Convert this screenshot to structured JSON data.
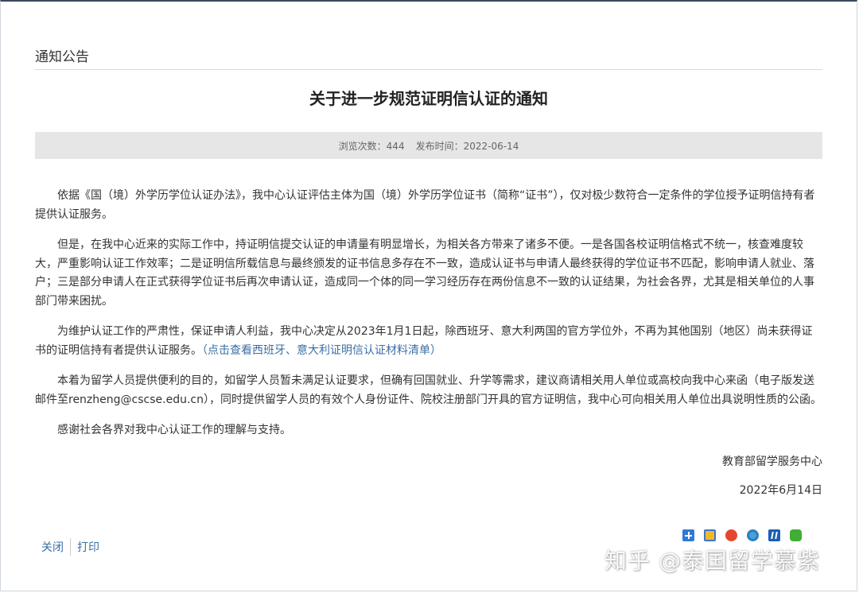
{
  "section": {
    "title": "通知公告"
  },
  "article": {
    "title": "关于进一步规范证明信认证的通知",
    "meta": {
      "views_label": "浏览次数：",
      "views": "444",
      "date_label": "发布时间：",
      "date": "2022-06-14"
    },
    "paragraphs": [
      "依据《国（境）外学历学位认证办法》，我中心认证评估主体为国（境）外学历学位证书（简称“证书”），仅对极少数符合一定条件的学位授予证明信持有者提供认证服务。",
      "但是，在我中心近来的实际工作中，持证明信提交认证的申请量有明显增长，为相关各方带来了诸多不便。一是各国各校证明信格式不统一，核查难度较大，严重影响认证工作效率；二是证明信所载信息与最终颁发的证书信息多存在不一致，造成认证书与申请人最终获得的学位证书不匹配，影响申请人就业、落户；三是部分申请人在正式获得学位证书后再次申请认证，造成同一个体的同一学习经历存在两份信息不一致的认证结果，为社会各界，尤其是相关单位的人事部门带来困扰。",
      "为维护认证工作的严肃性，保证申请人利益，我中心决定从2023年1月1日起，除西班牙、意大利两国的官方学位外，不再为其他国别（地区）尚未获得证书的证明信持有者提供认证服务。",
      "本着为留学人员提供便利的目的，如留学人员暂未满足认证要求，但确有回国就业、升学等需求，建议商请相关用人单位或高校向我中心来函（电子版发送邮件至renzheng@cscse.edu.cn），同时提供留学人员的有效个人身份证件、院校注册部门开具的官方证明信，我中心可向相关用人单位出具说明性质的公函。",
      "感谢社会各界对我中心认证工作的理解与支持。"
    ],
    "link_text": "（点击查看西班牙、意大利证明信认证材料清单）",
    "signature_org": "教育部留学服务中心",
    "signature_date": "2022年6月14日"
  },
  "footer": {
    "close_label": "关闭",
    "print_label": "打印"
  },
  "share": {
    "icons": [
      "add-share-icon",
      "qzone-icon",
      "weibo-icon",
      "tencent-weibo-icon",
      "renren-icon",
      "wechat-icon"
    ]
  },
  "watermark": {
    "text": "知乎 @泰国留学慕紫"
  }
}
